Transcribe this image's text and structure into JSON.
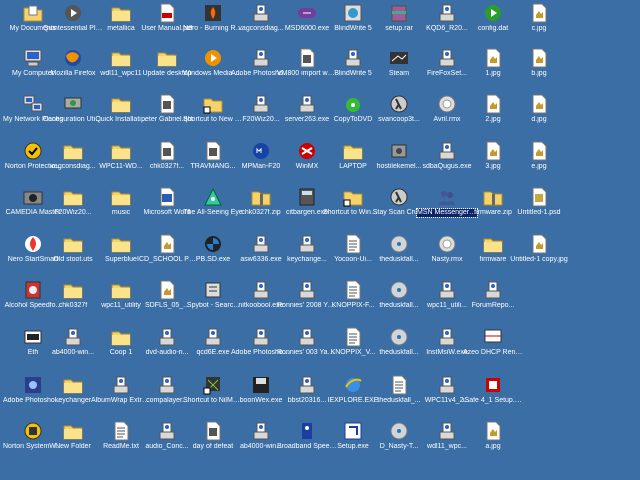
{
  "desktop": {
    "columns": [
      [
        {
          "label": "My Documents",
          "icon": "my-documents-icon"
        },
        {
          "label": "My Computer",
          "icon": "my-computer-icon"
        },
        {
          "label": "My Network Places",
          "icon": "network-places-icon"
        },
        {
          "label": "Norton Protectio...",
          "icon": "norton-shield-icon"
        },
        {
          "label": "CAMEDIA Master",
          "icon": "camera-app-icon"
        },
        {
          "label": "Nero StartSmart",
          "icon": "nero-flame-icon"
        },
        {
          "label": "Alcohol Speedfo...",
          "icon": "alcohol-app-icon"
        },
        {
          "label": "Eth",
          "icon": "ethereal-app-icon"
        },
        {
          "label": "Adobe Photoshop ...",
          "icon": "photoshop-app-icon"
        },
        {
          "label": "Norton SystemWorks",
          "icon": "norton-systemworks-icon"
        }
      ],
      [
        {
          "label": "Quintessential Player",
          "icon": "media-player-icon"
        },
        {
          "label": "Mozilla Firefox",
          "icon": "firefox-icon"
        },
        {
          "label": "Configuration Utility",
          "icon": "config-utility-icon"
        },
        {
          "label": "vagconsdiag...",
          "icon": "folder-icon"
        },
        {
          "label": "F20Wiz20...",
          "icon": "folder-icon"
        },
        {
          "label": "Old stoot.uts",
          "icon": "folder-icon"
        },
        {
          "label": "chk0327f",
          "icon": "folder-icon"
        },
        {
          "label": "ab4000-win...",
          "icon": "installer-icon"
        },
        {
          "label": "keychanger",
          "icon": "folder-icon"
        },
        {
          "label": "New Folder",
          "icon": "folder-icon"
        }
      ],
      [
        {
          "label": "metallica",
          "icon": "folder-icon"
        },
        {
          "label": "wdl11_wpc11",
          "icon": "folder-icon"
        },
        {
          "label": "Quick Installati...",
          "icon": "folder-icon"
        },
        {
          "label": "WPC11-WD...",
          "icon": "folder-icon"
        },
        {
          "label": "music",
          "icon": "folder-icon"
        },
        {
          "label": "Superblue",
          "icon": "folder-icon"
        },
        {
          "label": "wpc11_utility",
          "icon": "folder-icon"
        },
        {
          "label": "Coop 1",
          "icon": "folder-icon"
        },
        {
          "label": "AlbumWrap Extracto...",
          "icon": "installer-icon"
        },
        {
          "label": "ReadMe.txt",
          "icon": "text-document-icon"
        }
      ],
      [
        {
          "label": "User Manual.pdf",
          "icon": "pdf-document-icon"
        },
        {
          "label": "Update desktop",
          "icon": "folder-icon"
        },
        {
          "label": "peter Gabriel.qct",
          "icon": "document-icon"
        },
        {
          "label": "chk0327f...",
          "icon": "document-icon"
        },
        {
          "label": "Microsoft Word",
          "icon": "word-document-icon"
        },
        {
          "label": "ICD_SCHOOL PHOTO.jpg",
          "icon": "image-file-icon"
        },
        {
          "label": "SDFLS_05_...",
          "icon": "image-file-icon"
        },
        {
          "label": "dvd-audio-ri...",
          "icon": "installer-icon"
        },
        {
          "label": "compalayer...",
          "icon": "installer-icon"
        },
        {
          "label": "audio_Conc...",
          "icon": "installer-icon"
        }
      ],
      [
        {
          "label": "Nero - Burning Rom",
          "icon": "nero-burn-icon"
        },
        {
          "label": "Windows Media Player",
          "icon": "windows-media-player-icon"
        },
        {
          "label": "Shortcut to New Folder...",
          "icon": "shortcut-folder-icon"
        },
        {
          "label": "TRAVMANG...",
          "icon": "document-icon"
        },
        {
          "label": "The All-Seeing Eye",
          "icon": "all-seeing-eye-icon"
        },
        {
          "label": "PB.SD.exe",
          "icon": "bmw-logo-icon"
        },
        {
          "label": "Spybot - Searc...",
          "icon": "spybot-icon"
        },
        {
          "label": "qcd6E.exe",
          "icon": "installer-icon"
        },
        {
          "label": "Shortcut to NilMenE.exe",
          "icon": "shortcut-app-icon"
        },
        {
          "label": "day of defeat",
          "icon": "document-icon"
        }
      ],
      [
        {
          "label": "vagconsdiag...",
          "icon": "installer-icon"
        },
        {
          "label": "Adobe Photoshop ...",
          "icon": "installer-icon"
        },
        {
          "label": "F20Wiz20...",
          "icon": "installer-icon"
        },
        {
          "label": "MPMan-F20",
          "icon": "mpman-icon"
        },
        {
          "label": "chk0327f.zip",
          "icon": "zip-archive-icon"
        },
        {
          "label": "asw6336.exe",
          "icon": "installer-icon"
        },
        {
          "label": "nitkoobool.exe",
          "icon": "installer-icon"
        },
        {
          "label": "Adobe Photoshop ...",
          "icon": "installer-icon"
        },
        {
          "label": "boonWex.exe",
          "icon": "disk-app-icon"
        },
        {
          "label": "ab4000-win...",
          "icon": "installer-icon"
        }
      ],
      [
        {
          "label": "MSD6000.exe",
          "icon": "media-app-icon"
        },
        {
          "label": "VM800 import wotabuild",
          "icon": "document-icon"
        },
        {
          "label": "server263.exe",
          "icon": "installer-icon"
        },
        {
          "label": "WinMX",
          "icon": "winmx-icon"
        },
        {
          "label": "citbargen.exe",
          "icon": "calculator-app-icon"
        },
        {
          "label": "keychange...",
          "icon": "installer-icon"
        },
        {
          "label": "Ronnies' 2008 Yamaha Dir...",
          "icon": "installer-icon"
        },
        {
          "label": "Ronnies' 003 Yamaha Dir...",
          "icon": "installer-icon"
        },
        {
          "label": "bbst20316...",
          "icon": "installer-icon"
        },
        {
          "label": "Broadband Speed Test",
          "icon": "speed-test-icon"
        }
      ],
      [
        {
          "label": "BlindWrite 5",
          "icon": "blindwrite-icon"
        },
        {
          "label": "BlindWrite 5",
          "icon": "installer-icon"
        },
        {
          "label": "CopyToDVD",
          "icon": "copytodvd-icon"
        },
        {
          "label": "LAPTOP",
          "icon": "folder-icon"
        },
        {
          "label": "Shortcut to WinMx.do...",
          "icon": "shortcut-folder-icon"
        },
        {
          "label": "Yocoon-Ui...",
          "icon": "text-document-icon"
        },
        {
          "label": "KNOPPIX-F...",
          "icon": "text-document-icon"
        },
        {
          "label": "KNOPPIX_V...",
          "icon": "text-document-icon"
        },
        {
          "label": "IEXPLORE.EXE",
          "icon": "internet-explorer-icon"
        },
        {
          "label": "Setup.exe",
          "icon": "setup-app-icon"
        }
      ],
      [
        {
          "label": "setup.rar",
          "icon": "archive-icon"
        },
        {
          "label": "Steam",
          "icon": "steam-icon"
        },
        {
          "label": "svancoop3t...",
          "icon": "half-life-icon"
        },
        {
          "label": "hostilekemel...",
          "icon": "app-icon"
        },
        {
          "label": "Stay Scan Cruisr",
          "icon": "half-life-icon"
        },
        {
          "label": "theduskfall...",
          "icon": "cd-disc-icon"
        },
        {
          "label": "theduskfall...",
          "icon": "cd-disc-icon"
        },
        {
          "label": "theduskfall...",
          "icon": "cd-disc-icon"
        },
        {
          "label": "theduskfall_...",
          "icon": "text-document-icon"
        },
        {
          "label": "D_Nasty-T...",
          "icon": "cd-disc-icon"
        }
      ],
      [
        {
          "label": "KQD6_R20...",
          "icon": "installer-icon"
        },
        {
          "label": "FireFoxSet...",
          "icon": "installer-icon"
        },
        {
          "label": "Avril.rmx",
          "icon": "media-file-icon"
        },
        {
          "label": "sdbaQugus.exe",
          "icon": "installer-icon"
        },
        {
          "label": "MSN Messenger 6.2",
          "icon": "msn-messenger-icon",
          "selected": true
        },
        {
          "label": "Nasty.rmx",
          "icon": "media-file-icon"
        },
        {
          "label": "wpc11_utili...",
          "icon": "installer-icon"
        },
        {
          "label": "InstMsiW.exe",
          "icon": "installer-icon"
        },
        {
          "label": "WPC11v4_2...",
          "icon": "installer-icon"
        },
        {
          "label": "wdl11_wpc...",
          "icon": "installer-icon"
        }
      ],
      [
        {
          "label": "config.dat",
          "icon": "play-button-icon"
        },
        {
          "label": "1.jpg",
          "icon": "image-file-icon"
        },
        {
          "label": "2.jpg",
          "icon": "image-file-icon"
        },
        {
          "label": "3.jpg",
          "icon": "image-file-icon"
        },
        {
          "label": "firmware.zip",
          "icon": "zip-archive-icon"
        },
        {
          "label": "firmware",
          "icon": "folder-icon"
        },
        {
          "label": "ForumRepo...",
          "icon": "installer-icon"
        },
        {
          "label": "Azeo DHCP Renew",
          "icon": "network-app-icon"
        },
        {
          "label": "iSafe 4_1 Setup.exe",
          "icon": "isafe-icon"
        },
        {
          "label": "a.jpg",
          "icon": "image-file-icon"
        }
      ],
      [
        {
          "label": "c.jpg",
          "icon": "image-file-icon"
        },
        {
          "label": "b.jpg",
          "icon": "image-file-icon"
        },
        {
          "label": "d.jpg",
          "icon": "image-file-icon"
        },
        {
          "label": "e.jpg",
          "icon": "image-file-icon"
        },
        {
          "label": "Untitled-1.psd",
          "icon": "photoshop-file-icon"
        },
        {
          "label": "Untitled-1 copy.jpg",
          "icon": "image-file-icon"
        }
      ]
    ]
  }
}
